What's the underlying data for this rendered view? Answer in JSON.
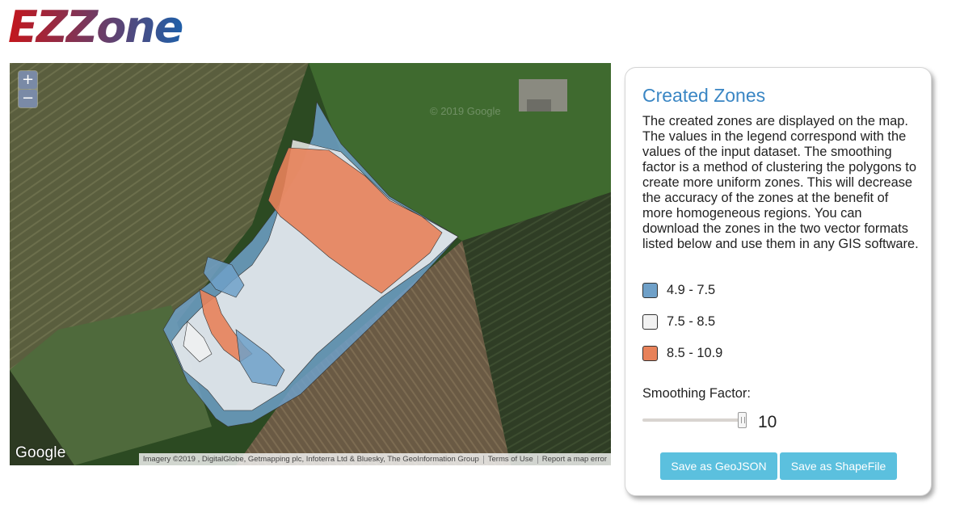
{
  "logo": {
    "text": "EZZone",
    "gradient_start": "#c4161c",
    "gradient_end": "#1f5fa8"
  },
  "map": {
    "zoom_in": "+",
    "zoom_out": "−",
    "provider": "Google",
    "attribution": "Imagery ©2019 , DigitalGlobe, Getmapping plc, Infoterra Ltd & Bluesky, The GeoInformation Group",
    "terms": "Terms of Use",
    "report": "Report a map error",
    "watermark": "© 2019 Google"
  },
  "panel": {
    "title": "Created Zones",
    "description": "The created zones are displayed on the map. The values in the legend correspond with the values of the input dataset. The smoothing factor is a method of clustering the polygons to create more uniform zones. This will decrease the accuracy of the zones at the benefit of more homogeneous regions. You can download the zones in the two vector formats listed below and use them in any GIS software.",
    "legend": [
      {
        "label": "4.9 - 7.5",
        "color": "#6fa0c8"
      },
      {
        "label": "7.5 - 8.5",
        "color": "#f2f2f2"
      },
      {
        "label": "8.5 - 10.9",
        "color": "#e8825a"
      }
    ],
    "smoothing_label": "Smoothing Factor:",
    "smoothing_value": "10",
    "save_geojson": "Save as GeoJSON",
    "save_shapefile": "Save as ShapeFile"
  }
}
